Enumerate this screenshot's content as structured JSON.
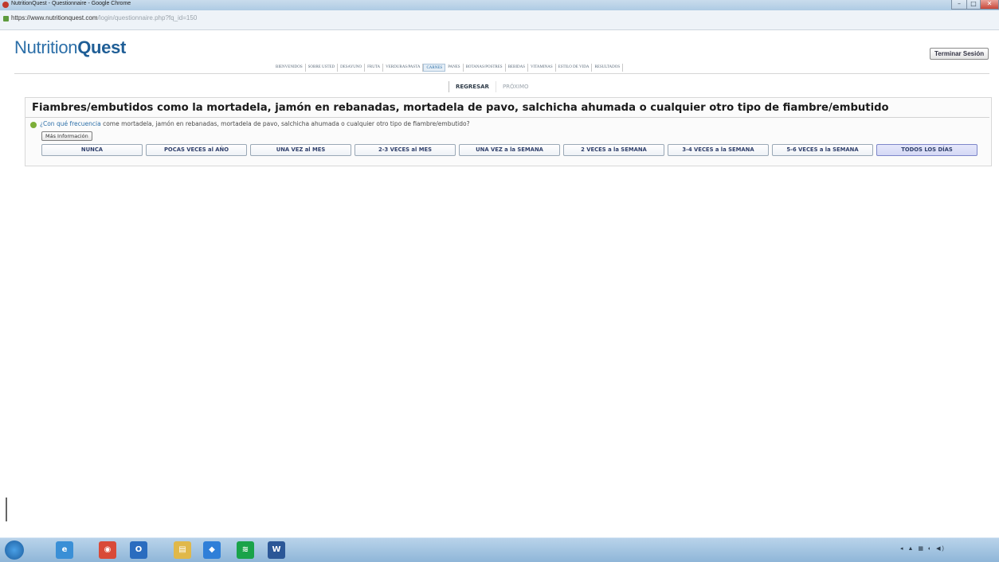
{
  "window": {
    "title": "NutritionQuest - Questionnaire - Google Chrome",
    "controls": {
      "minimize": "–",
      "maximize": "□",
      "close": "✕"
    }
  },
  "address": {
    "url_main": "https://www.nutritionquest.com",
    "url_path": "/login/questionnaire.php?fq_id=150"
  },
  "header": {
    "logo_light": "Nutrition",
    "logo_bold": "Quest",
    "logout_label": "Terminar Sesión"
  },
  "nav": {
    "tabs": [
      {
        "label": "BIENVENIDOS",
        "active": false
      },
      {
        "label": "SOBRE USTED",
        "active": false
      },
      {
        "label": "DESAYUNO",
        "active": false
      },
      {
        "label": "FRUTA",
        "active": false
      },
      {
        "label": "VERDURAS/PASTA",
        "active": false
      },
      {
        "label": "CARNES",
        "active": true
      },
      {
        "label": "PANES",
        "active": false
      },
      {
        "label": "BOTANAS/POSTRES",
        "active": false
      },
      {
        "label": "BEBIDAS",
        "active": false
      },
      {
        "label": "VITAMINAS",
        "active": false
      },
      {
        "label": "ESTILO DE VIDA",
        "active": false
      },
      {
        "label": "RESULTADOS",
        "active": false
      }
    ]
  },
  "pager": {
    "back_label": "REGRESAR",
    "next_label": "PRÓXIMO"
  },
  "question": {
    "title": "Fiambres/embutidos como la mortadela, jamón en rebanadas, mortadela de pavo, salchicha ahumada o cualquier otro tipo de fiambre/embutido",
    "prompt_link": "¿Con qué frecuencia",
    "prompt_rest": " come mortadela, jamón en rebanadas, mortadela de pavo, salchicha ahumada o cualquier otro tipo de fiambre/embutido?",
    "more_info_label": "Más Información",
    "options": [
      "NUNCA",
      "POCAS VECES al AÑO",
      "UNA VEZ al MES",
      "2-3 VECES al MES",
      "UNA VEZ a la SEMANA",
      "2 VECES a la SEMANA",
      "3-4 VECES a la SEMANA",
      "5-6 VECES a la SEMANA",
      "TODOS LOS DÍAS"
    ]
  },
  "taskbar": {
    "apps": [
      {
        "icon": "ie-icon",
        "glyph": "e",
        "color": "#3a8fd6"
      },
      {
        "icon": "chrome-icon",
        "glyph": "◉",
        "color": "#d94a38"
      },
      {
        "icon": "outlook-icon",
        "glyph": "O",
        "color": "#2a6cbf"
      },
      {
        "icon": "explorer-icon",
        "glyph": "▤",
        "color": "#e0b84a"
      },
      {
        "icon": "dropbox-icon",
        "glyph": "◆",
        "color": "#2f7fd8"
      },
      {
        "icon": "spotify-icon",
        "glyph": "≋",
        "color": "#1aa34a"
      },
      {
        "icon": "word-icon",
        "glyph": "W",
        "color": "#2b5797"
      }
    ],
    "tray_icons": "◂ ▲ ▦ ◐ ◀)"
  }
}
